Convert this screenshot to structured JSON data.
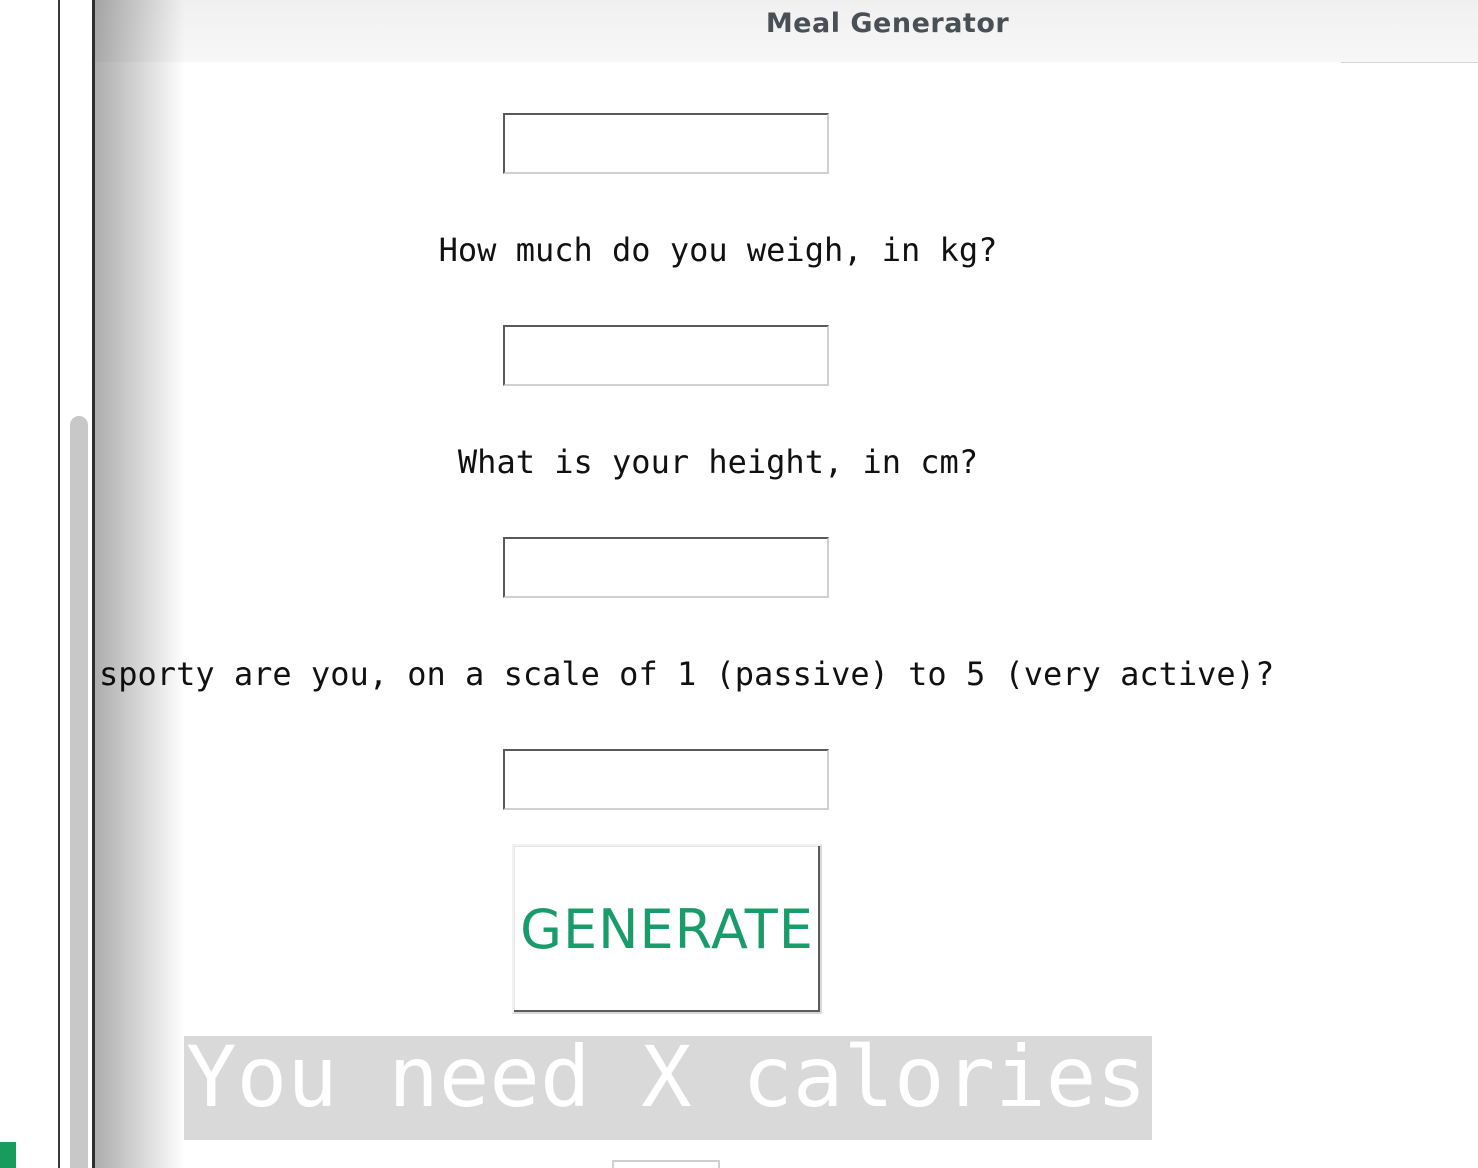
{
  "window": {
    "title": "Meal Generator"
  },
  "form": {
    "fields": [
      {
        "label": "",
        "value": ""
      },
      {
        "label": "How much do you weigh, in kg?",
        "value": ""
      },
      {
        "label": "What is your height, in cm?",
        "value": ""
      },
      {
        "label": "sporty are you, on a scale of 1 (passive) to 5 (very active)?",
        "value": ""
      }
    ],
    "generate_label": "GENERATE",
    "result_text": "You need X calories!"
  },
  "colors": {
    "accent_green": "#1a9b6a",
    "result_background": "#d9d9d9",
    "result_text": "#ffffff"
  }
}
